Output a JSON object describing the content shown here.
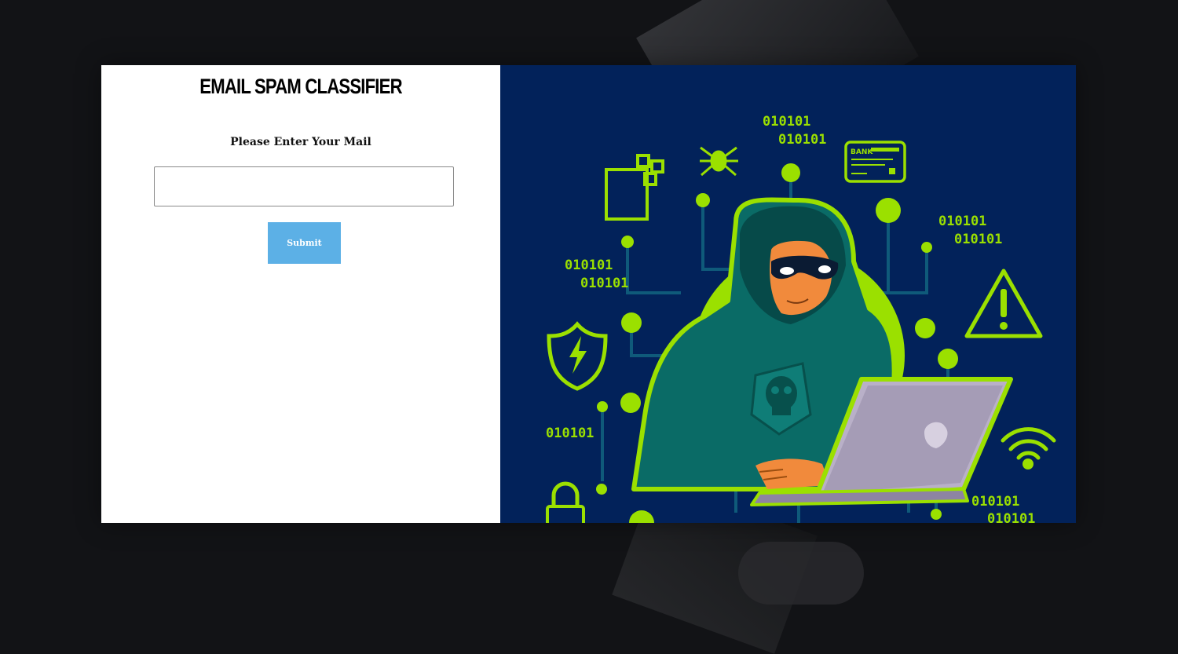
{
  "app": {
    "title": "Email Spam Classifier"
  },
  "form": {
    "heading": "EMAIL SPAM CLASSIFIER",
    "label": "Please Enter Your Mail",
    "input_value": "",
    "input_placeholder": "",
    "submit_label": "Submit"
  },
  "illustration": {
    "binary_texts": [
      "010101",
      "010101",
      "010101",
      "010101",
      "010101",
      "010101",
      "010101",
      "010101",
      "010101",
      "010101"
    ],
    "bank_label": "BANK",
    "icons": [
      "file-icon",
      "spider-icon",
      "bank-card-icon",
      "warning-icon",
      "shield-lightning-icon",
      "padlock-icon",
      "wifi-icon",
      "skull-icon",
      "hacker-figure",
      "laptop-icon"
    ]
  },
  "colors": {
    "accent": "#5cb0e6",
    "illustration_bg": "#02225a",
    "neon_green": "#9be000",
    "hoodie": "#0a6b66",
    "laptop": "#b9b0c8",
    "skin": "#f18a3c",
    "page_bg": "#121316"
  }
}
